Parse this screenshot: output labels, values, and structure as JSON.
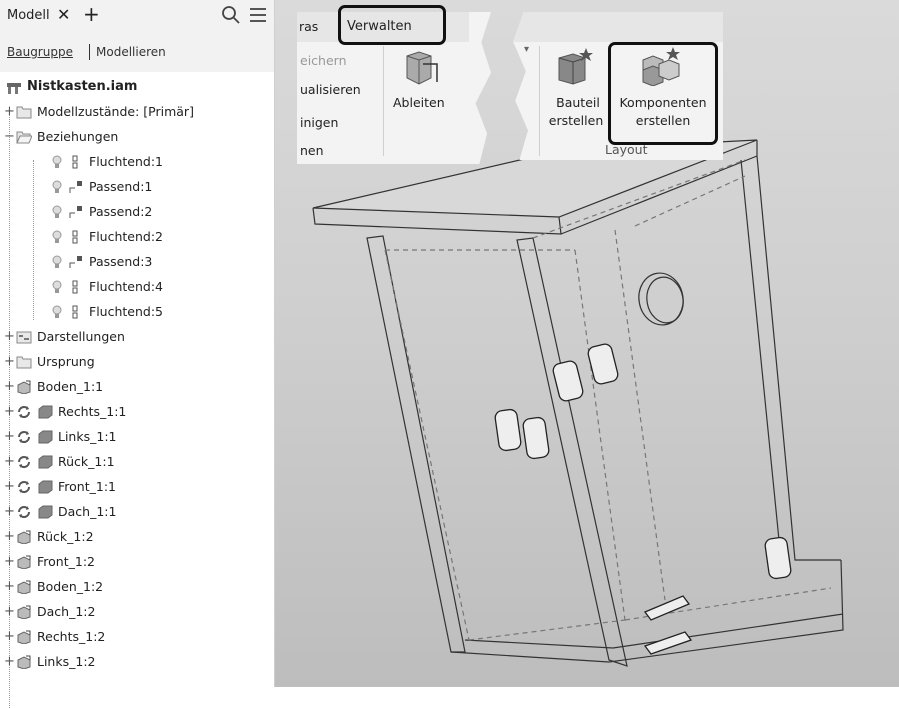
{
  "browser": {
    "tab": {
      "label": "Modell",
      "close_glyph": "✕",
      "add_glyph": "+"
    },
    "subtabs": {
      "assembly": "Baugruppe",
      "modeling": "Modellieren"
    },
    "tree": [
      {
        "label": "Nistkasten.iam",
        "icon": "assembly-icon",
        "expander": ""
      },
      {
        "label": "Modellzustände: [Primär]",
        "icon": "folder-icon",
        "expander": "+"
      },
      {
        "label": "Beziehungen",
        "icon": "folder-open-icon",
        "expander": "−"
      },
      {
        "label": "Fluchtend:1",
        "icon": "flush-constraint-icon",
        "expander": ""
      },
      {
        "label": "Passend:1",
        "icon": "mate-constraint-icon",
        "expander": ""
      },
      {
        "label": "Passend:2",
        "icon": "mate-constraint-icon",
        "expander": ""
      },
      {
        "label": "Fluchtend:2",
        "icon": "flush-constraint-icon",
        "expander": ""
      },
      {
        "label": "Passend:3",
        "icon": "mate-constraint-icon",
        "expander": ""
      },
      {
        "label": "Fluchtend:4",
        "icon": "flush-constraint-icon",
        "expander": ""
      },
      {
        "label": "Fluchtend:5",
        "icon": "flush-constraint-icon",
        "expander": ""
      },
      {
        "label": "Darstellungen",
        "icon": "representations-icon",
        "expander": "+"
      },
      {
        "label": "Ursprung",
        "icon": "folder-icon",
        "expander": "+"
      },
      {
        "label": "Boden_1:1",
        "icon": "part-icon",
        "expander": "+"
      },
      {
        "label": "Rechts_1:1",
        "icon": "pattern-part-icon",
        "expander": "+"
      },
      {
        "label": "Links_1:1",
        "icon": "pattern-part-icon",
        "expander": "+"
      },
      {
        "label": "Rück_1:1",
        "icon": "pattern-part-icon",
        "expander": "+"
      },
      {
        "label": "Front_1:1",
        "icon": "pattern-part-icon",
        "expander": "+"
      },
      {
        "label": "Dach_1:1",
        "icon": "pattern-part-icon",
        "expander": "+"
      },
      {
        "label": "Rück_1:2",
        "icon": "part-icon",
        "expander": "+"
      },
      {
        "label": "Front_1:2",
        "icon": "part-icon",
        "expander": "+"
      },
      {
        "label": "Boden_1:2",
        "icon": "part-icon",
        "expander": "+"
      },
      {
        "label": "Dach_1:2",
        "icon": "part-icon",
        "expander": "+"
      },
      {
        "label": "Rechts_1:2",
        "icon": "part-icon",
        "expander": "+"
      },
      {
        "label": "Links_1:2",
        "icon": "part-icon",
        "expander": "+"
      }
    ]
  },
  "ribbon": {
    "tabs": {
      "partial_left": "ras",
      "active": "Verwalten"
    },
    "left_items": {
      "save": "eichern",
      "visualize": "ualisieren",
      "clean": "inigen",
      "bottom": "nen"
    },
    "derive": "Ableiten",
    "create_part": {
      "line1": "Bauteil",
      "line2": "erstellen"
    },
    "create_components": {
      "line1": "Komponenten",
      "line2": "erstellen"
    },
    "panel_label": "Layout"
  },
  "colors": {
    "highlight": "#111111",
    "ribbon_bg": "#f3f3f3",
    "viewport_top": "#dadada",
    "viewport_bottom": "#bdbdbd"
  }
}
